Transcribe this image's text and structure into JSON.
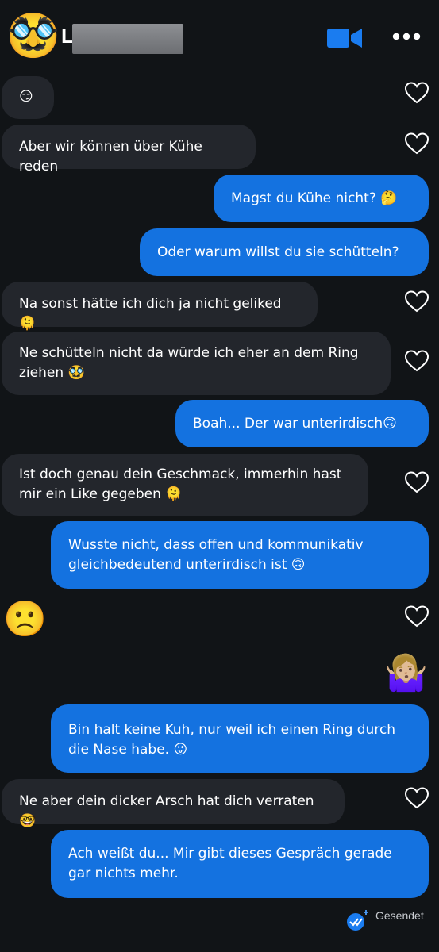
{
  "header": {
    "avatar_emoji": "🥸",
    "name_initial": "L",
    "video_icon": "video-call-icon",
    "more_icon": "more-options-icon",
    "accent": "#1472e0"
  },
  "messages": [
    {
      "dir": "in",
      "text": "😏"
    },
    {
      "dir": "in",
      "text": "Aber wir können über Kühe reden"
    },
    {
      "dir": "out",
      "text": "Magst du Kühe nicht? 🤔"
    },
    {
      "dir": "out",
      "text": "Oder warum willst du sie schütteln?"
    },
    {
      "dir": "in",
      "text": "Na sonst hätte ich dich ja nicht geliked 🫠"
    },
    {
      "dir": "in",
      "text": "Ne schütteln nicht da würde ich eher an dem Ring ziehen 🥸"
    },
    {
      "dir": "out",
      "text": "Boah... Der war unterirdisch🙃"
    },
    {
      "dir": "in",
      "text": "Ist doch genau dein Geschmack, immerhin hast mir ein Like gegeben 🫠"
    },
    {
      "dir": "out",
      "text": "Wusste nicht, dass offen und kommunikativ gleichbedeutend unterirdisch ist 🙃"
    },
    {
      "dir": "in",
      "text": "🙁"
    },
    {
      "dir": "out",
      "text": "🤷🏼‍♀️"
    },
    {
      "dir": "out",
      "text": "Bin halt keine Kuh, nur weil ich einen Ring durch die Nase habe. 😜"
    },
    {
      "dir": "in",
      "text": "Ne aber dein dicker Arsch hat dich verraten 🤓"
    },
    {
      "dir": "out",
      "text": "Ach weißt du... Mir gibt dieses Gespräch gerade gar nichts mehr."
    }
  ],
  "status": {
    "icon": "double-check-icon",
    "label": "Gesendet"
  }
}
